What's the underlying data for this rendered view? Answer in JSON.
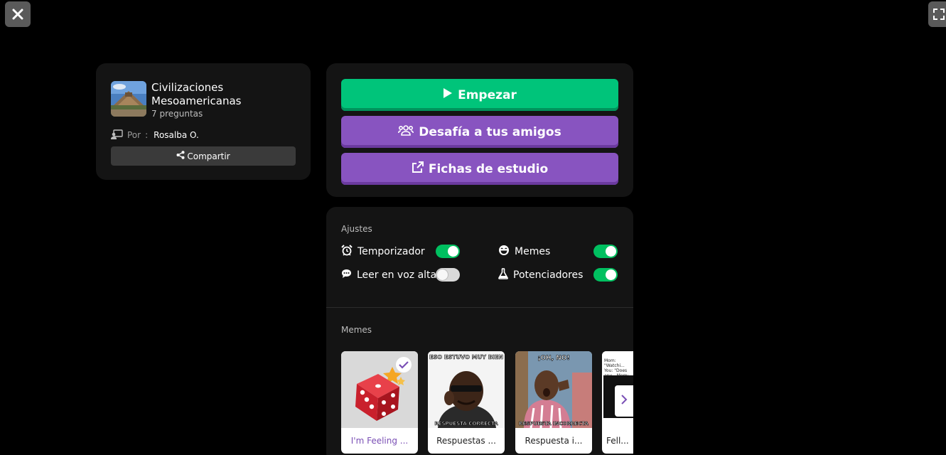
{
  "quiz": {
    "title": "Civilizaciones Mesoamericanas",
    "question_count": "7 preguntas",
    "author_prefix": "Por",
    "author_sep": ":",
    "author_name": "Rosalba O.",
    "share_label": "Compartir"
  },
  "actions": {
    "start_label": "Empezar",
    "challenge_label": "Desafía a tus amigos",
    "flashcards_label": "Fichas de estudio"
  },
  "settings": {
    "section_title": "Ajustes",
    "items": [
      {
        "label": "Temporizador",
        "enabled": true,
        "icon": "alarm-clock-icon"
      },
      {
        "label": "Memes",
        "enabled": true,
        "icon": "laughing-face-icon"
      },
      {
        "label": "Leer en voz alta",
        "enabled": false,
        "icon": "speech-bubble-icon"
      },
      {
        "label": "Potenciadores",
        "enabled": true,
        "icon": "flask-icon"
      }
    ]
  },
  "memes": {
    "section_title": "Memes",
    "items": [
      {
        "caption": "I'm Feeling ...",
        "selected": true
      },
      {
        "caption": "Respuestas ...",
        "selected": false,
        "top_text": "ESO ESTUVO MUY BIEN",
        "bottom_text": "RESPUESTA CORRECTA"
      },
      {
        "caption": "Respuesta i...",
        "selected": false,
        "top_text": "¡OH, NO!",
        "bottom_text": "RESPUESTA INCORRECTA"
      },
      {
        "caption": "Fell...",
        "selected": false,
        "top_text": "Mom: \"Watchi... You: \"Does any... Mom:"
      }
    ]
  },
  "colors": {
    "primary_green": "#00c47a",
    "primary_purple": "#8854c0",
    "toggle_on": "#00c060",
    "card_bg": "#141414"
  }
}
